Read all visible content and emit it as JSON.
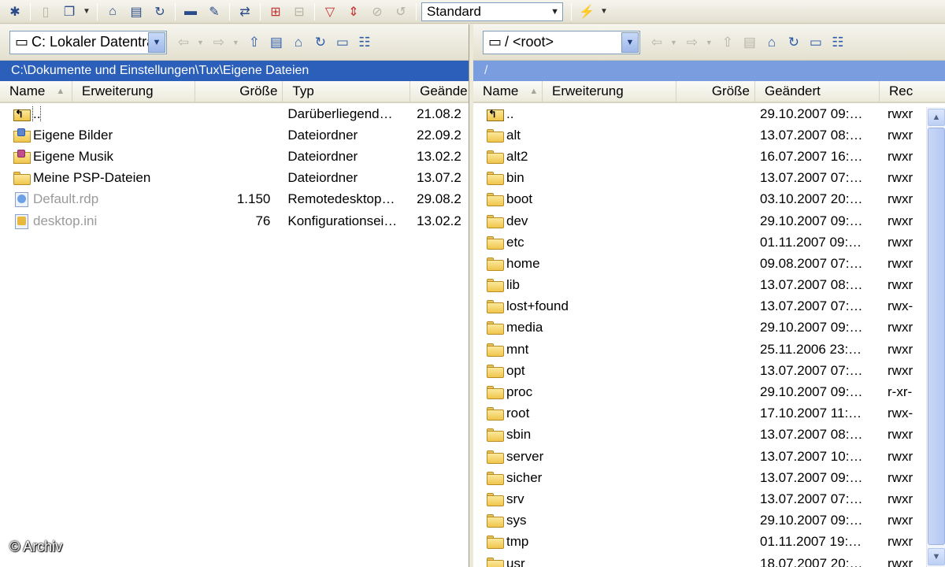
{
  "toolbar": {
    "view_mode": "Standard",
    "icons": [
      "gear-icon",
      "ftp-icon",
      "copy-names-icon",
      "share-icon",
      "unpack-icon",
      "refresh-icon",
      "hex-view-icon",
      "edit-icon",
      "sync-icon",
      "select-all-icon",
      "deselect-icon",
      "filter-icon",
      "swap-icon",
      "cancel-icon",
      "undo-icon",
      "lightning-icon"
    ]
  },
  "left": {
    "drive": "C: Lokaler Datenträger",
    "path": "C:\\Dokumente und Einstellungen\\Tux\\Eigene Dateien",
    "columns": [
      "Name",
      "Erweiterung",
      "Größe",
      "Typ",
      "Geände"
    ],
    "rows": [
      {
        "icon": "up",
        "name": "..",
        "ext": "",
        "size": "",
        "type": "Darüberliegend…",
        "date": "21.08.2"
      },
      {
        "icon": "pics",
        "name": "Eigene Bilder",
        "ext": "",
        "size": "",
        "type": "Dateiordner",
        "date": "22.09.2"
      },
      {
        "icon": "music",
        "name": "Eigene Musik",
        "ext": "",
        "size": "",
        "type": "Dateiordner",
        "date": "13.02.2"
      },
      {
        "icon": "folder",
        "name": "Meine PSP-Dateien",
        "ext": "",
        "size": "",
        "type": "Dateiordner",
        "date": "13.07.2"
      },
      {
        "icon": "rdp",
        "name": "Default.rdp",
        "ext": "",
        "size": "1.150",
        "type": "Remotedesktop…",
        "date": "29.08.2",
        "hidden": true
      },
      {
        "icon": "cfg",
        "name": "desktop.ini",
        "ext": "",
        "size": "76",
        "type": "Konfigurationsei…",
        "date": "13.02.2",
        "hidden": true
      }
    ]
  },
  "right": {
    "drive": "/ <root>",
    "path": "/",
    "columns": [
      "Name",
      "Erweiterung",
      "Größe",
      "Geändert",
      "Rec"
    ],
    "rows": [
      {
        "icon": "up",
        "name": "..",
        "date": "29.10.2007 09:…",
        "perm": "rwxr"
      },
      {
        "icon": "folder",
        "name": "alt",
        "date": "13.07.2007 08:…",
        "perm": "rwxr"
      },
      {
        "icon": "folder",
        "name": "alt2",
        "date": "16.07.2007 16:…",
        "perm": "rwxr"
      },
      {
        "icon": "folder",
        "name": "bin",
        "date": "13.07.2007 07:…",
        "perm": "rwxr"
      },
      {
        "icon": "folder",
        "name": "boot",
        "date": "03.10.2007 20:…",
        "perm": "rwxr"
      },
      {
        "icon": "folder",
        "name": "dev",
        "date": "29.10.2007 09:…",
        "perm": "rwxr"
      },
      {
        "icon": "folder",
        "name": "etc",
        "date": "01.11.2007 09:…",
        "perm": "rwxr"
      },
      {
        "icon": "folder",
        "name": "home",
        "date": "09.08.2007 07:…",
        "perm": "rwxr"
      },
      {
        "icon": "folder",
        "name": "lib",
        "date": "13.07.2007 08:…",
        "perm": "rwxr"
      },
      {
        "icon": "folder",
        "name": "lost+found",
        "date": "13.07.2007 07:…",
        "perm": "rwx-"
      },
      {
        "icon": "folder",
        "name": "media",
        "date": "29.10.2007 09:…",
        "perm": "rwxr"
      },
      {
        "icon": "folder",
        "name": "mnt",
        "date": "25.11.2006 23:…",
        "perm": "rwxr"
      },
      {
        "icon": "folder",
        "name": "opt",
        "date": "13.07.2007 07:…",
        "perm": "rwxr"
      },
      {
        "icon": "folder",
        "name": "proc",
        "date": "29.10.2007 09:…",
        "perm": "r-xr-"
      },
      {
        "icon": "folder",
        "name": "root",
        "date": "17.10.2007 11:…",
        "perm": "rwx-"
      },
      {
        "icon": "folder",
        "name": "sbin",
        "date": "13.07.2007 08:…",
        "perm": "rwxr"
      },
      {
        "icon": "folder",
        "name": "server",
        "date": "13.07.2007 10:…",
        "perm": "rwxr"
      },
      {
        "icon": "folder",
        "name": "sicher",
        "date": "13.07.2007 09:…",
        "perm": "rwxr"
      },
      {
        "icon": "folder",
        "name": "srv",
        "date": "13.07.2007 07:…",
        "perm": "rwxr"
      },
      {
        "icon": "folder",
        "name": "sys",
        "date": "29.10.2007 09:…",
        "perm": "rwxr"
      },
      {
        "icon": "folder",
        "name": "tmp",
        "date": "01.11.2007 19:…",
        "perm": "rwxr"
      },
      {
        "icon": "folder",
        "name": "usr",
        "date": "18.07.2007 20:…",
        "perm": "rwxr"
      }
    ]
  },
  "watermark": "© Archiv"
}
